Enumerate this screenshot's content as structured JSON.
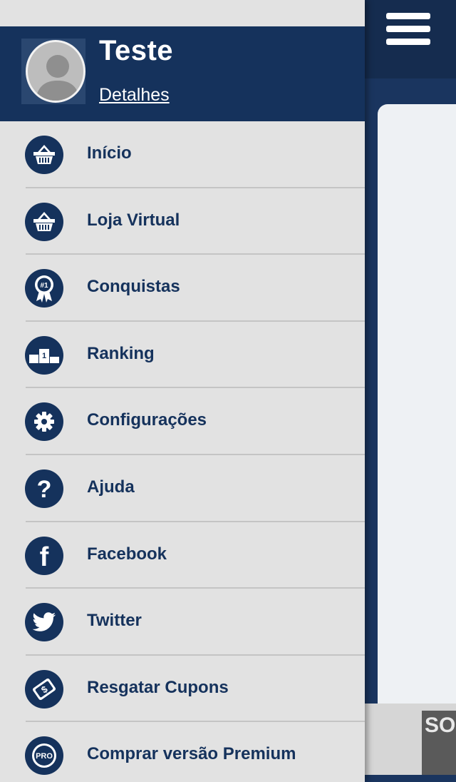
{
  "profile": {
    "name": "Teste",
    "details_link": "Detalhes"
  },
  "menu": [
    {
      "label": "Início",
      "icon": "basket-icon"
    },
    {
      "label": "Loja Virtual",
      "icon": "basket-icon"
    },
    {
      "label": "Conquistas",
      "icon": "award-ribbon-icon",
      "icon_text": "#1"
    },
    {
      "label": "Ranking",
      "icon": "podium-icon",
      "icon_text": "1"
    },
    {
      "label": "Configurações",
      "icon": "gear-icon"
    },
    {
      "label": "Ajuda",
      "icon": "question-icon",
      "icon_text": "?"
    },
    {
      "label": "Facebook",
      "icon": "facebook-icon",
      "icon_text": "f"
    },
    {
      "label": "Twitter",
      "icon": "twitter-bird-icon"
    },
    {
      "label": "Resgatar Cupons",
      "icon": "coupon-icon",
      "icon_text": "$"
    },
    {
      "label": "Comprar versão Premium",
      "icon": "pro-badge-icon",
      "icon_text": "PRO"
    }
  ],
  "background_app": {
    "ad_text": "SO"
  },
  "colors": {
    "navy": "#15325c",
    "drawer_bg": "#e2e2e2",
    "divider": "#c4c4c4"
  }
}
